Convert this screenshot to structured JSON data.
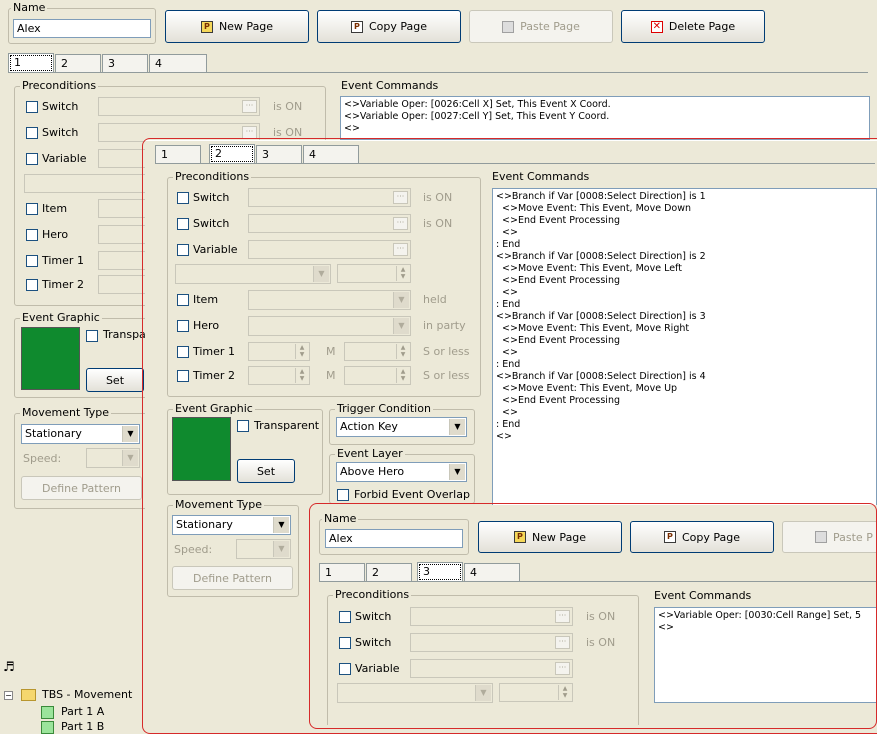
{
  "back": {
    "name_label": "Name",
    "name_value": "Alex",
    "new_page": "New Page",
    "copy_page": "Copy Page",
    "paste_page": "Paste Page",
    "delete_page": "Delete Page",
    "tabs": [
      "1",
      "2",
      "3",
      "4"
    ],
    "preconditions": "Preconditions",
    "switch_label": "Switch",
    "variable_label": "Variable",
    "item_label": "Item",
    "hero_label": "Hero",
    "timer1_label": "Timer 1",
    "timer2_label": "Timer 2",
    "is_on": "is ON",
    "event_commands": "Event Commands",
    "commands": [
      "<>Variable Oper: [0026:Cell X] Set, This Event X Coord.",
      "<>Variable Oper: [0027:Cell Y] Set, This Event Y Coord.",
      "<>"
    ],
    "event_graphic": "Event Graphic",
    "transparent": "Transpa",
    "set": "Set",
    "movement_type": "Movement Type",
    "movement_value": "Stationary",
    "speed": "Speed:",
    "define_pattern": "Define Pattern",
    "tree": {
      "root": "TBS - Movement",
      "items": [
        "Part 1 A",
        "Part 1 B"
      ]
    }
  },
  "mid": {
    "tabs": [
      "1",
      "2",
      "3",
      "4"
    ],
    "preconditions": "Preconditions",
    "switch_label": "Switch",
    "variable_label": "Variable",
    "item_label": "Item",
    "hero_label": "Hero",
    "timer1_label": "Timer 1",
    "timer2_label": "Timer 2",
    "is_on": "is ON",
    "held": "held",
    "in_party": "in party",
    "m": "M",
    "s_or_less": "S or less",
    "event_commands": "Event Commands",
    "commands": [
      "<>Branch if Var [0008:Select Direction] is 1",
      "  <>Move Event: This Event, Move Down",
      "  <>End Event Processing",
      "  <>",
      ": End",
      "<>Branch if Var [0008:Select Direction] is 2",
      "  <>Move Event: This Event, Move Left",
      "  <>End Event Processing",
      "  <>",
      ": End",
      "<>Branch if Var [0008:Select Direction] is 3",
      "  <>Move Event: This Event, Move Right",
      "  <>End Event Processing",
      "  <>",
      ": End",
      "<>Branch if Var [0008:Select Direction] is 4",
      "  <>Move Event: This Event, Move Up",
      "  <>End Event Processing",
      "  <>",
      ": End",
      "<>"
    ],
    "event_graphic": "Event Graphic",
    "transparent": "Transparent",
    "set": "Set",
    "trigger_condition": "Trigger Condition",
    "trigger_value": "Action Key",
    "event_layer": "Event Layer",
    "layer_value": "Above Hero",
    "forbid_overlap": "Forbid Event Overlap",
    "movement_type": "Movement Type",
    "movement_value": "Stationary",
    "speed": "Speed:",
    "define_pattern": "Define Pattern"
  },
  "front": {
    "name_label": "Name",
    "name_value": "Alex",
    "new_page": "New Page",
    "copy_page": "Copy Page",
    "paste_page": "Paste P",
    "tabs": [
      "1",
      "2",
      "3",
      "4"
    ],
    "preconditions": "Preconditions",
    "switch_label": "Switch",
    "variable_label": "Variable",
    "is_on": "is ON",
    "event_commands": "Event Commands",
    "commands": [
      "<>Variable Oper: [0030:Cell Range] Set, 5",
      "<>"
    ]
  },
  "colors": {
    "highlight_border": "#d62a2a",
    "graphic_bg": "#0f8a2e"
  }
}
